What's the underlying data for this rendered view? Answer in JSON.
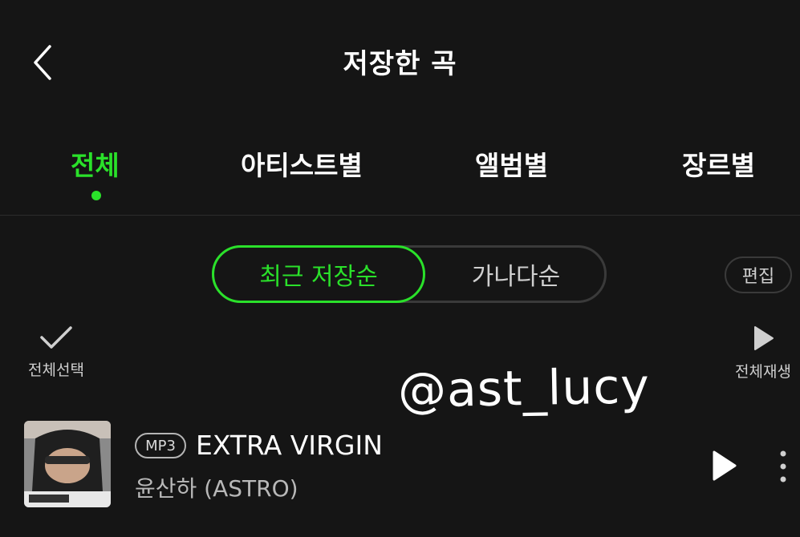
{
  "header": {
    "title": "저장한 곡",
    "back_icon": "chevron-left-icon"
  },
  "tabs": [
    {
      "label": "전체",
      "active": true
    },
    {
      "label": "아티스트별",
      "active": false
    },
    {
      "label": "앨범별",
      "active": false
    },
    {
      "label": "장르별",
      "active": false
    }
  ],
  "sort": {
    "options": [
      "최근 저장순",
      "가나다순"
    ],
    "selected": "최근 저장순"
  },
  "edit_label": "편집",
  "select_all_label": "전체선택",
  "play_all_label": "전체재생",
  "watermark": "@ast_lucy",
  "songs": [
    {
      "badge": "MP3",
      "title": "EXTRA VIRGIN",
      "artist": "윤산하 (ASTRO)"
    }
  ],
  "colors": {
    "accent": "#2ae12a",
    "background": "#151515"
  }
}
